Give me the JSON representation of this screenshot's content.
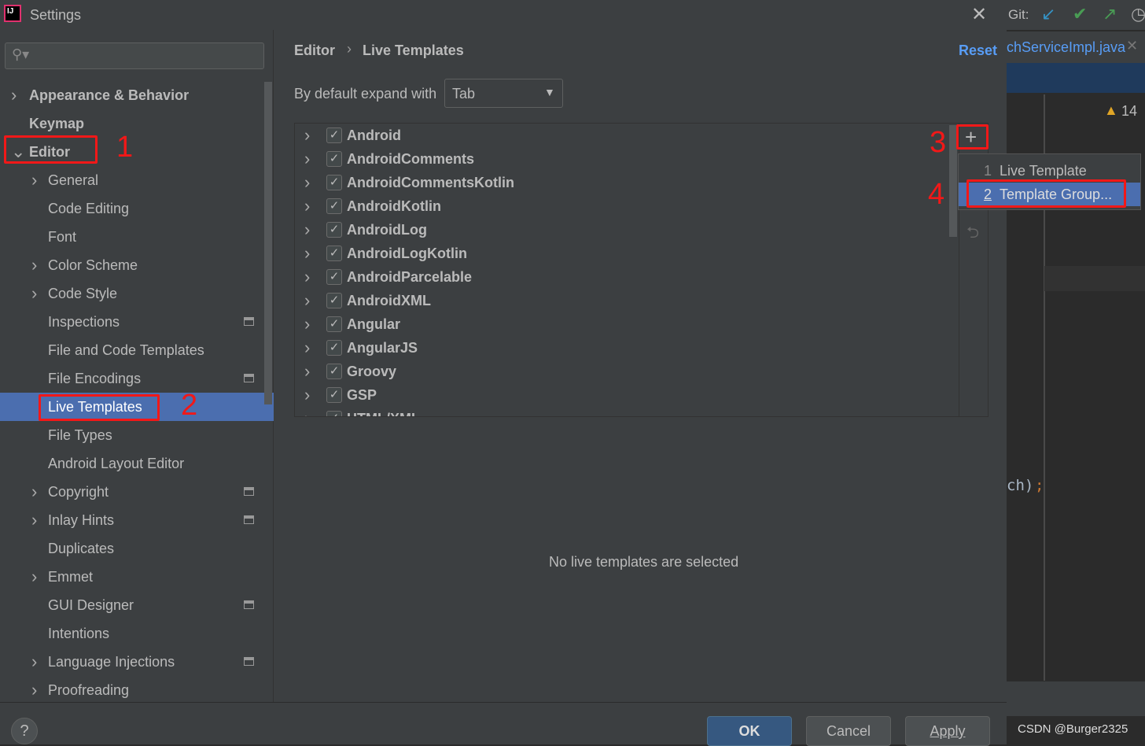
{
  "window": {
    "title": "Settings"
  },
  "search": {
    "placeholder": ""
  },
  "sidebar": {
    "items": [
      {
        "label": "Appearance & Behavior",
        "level": 0,
        "chevron": ">",
        "bold": true
      },
      {
        "label": "Keymap",
        "level": 0,
        "chevron": "",
        "bold": true
      },
      {
        "label": "Editor",
        "level": 0,
        "chevron": "v",
        "bold": true
      },
      {
        "label": "General",
        "level": 1,
        "chevron": ">"
      },
      {
        "label": "Code Editing",
        "level": 1,
        "chevron": ""
      },
      {
        "label": "Font",
        "level": 1,
        "chevron": ""
      },
      {
        "label": "Color Scheme",
        "level": 1,
        "chevron": ">"
      },
      {
        "label": "Code Style",
        "level": 1,
        "chevron": ">"
      },
      {
        "label": "Inspections",
        "level": 1,
        "chevron": "",
        "project": true
      },
      {
        "label": "File and Code Templates",
        "level": 1,
        "chevron": ""
      },
      {
        "label": "File Encodings",
        "level": 1,
        "chevron": "",
        "project": true
      },
      {
        "label": "Live Templates",
        "level": 1,
        "chevron": "",
        "selected": true
      },
      {
        "label": "File Types",
        "level": 1,
        "chevron": ""
      },
      {
        "label": "Android Layout Editor",
        "level": 1,
        "chevron": ""
      },
      {
        "label": "Copyright",
        "level": 1,
        "chevron": ">",
        "project": true
      },
      {
        "label": "Inlay Hints",
        "level": 1,
        "chevron": ">",
        "project": true
      },
      {
        "label": "Duplicates",
        "level": 1,
        "chevron": ""
      },
      {
        "label": "Emmet",
        "level": 1,
        "chevron": ">"
      },
      {
        "label": "GUI Designer",
        "level": 1,
        "chevron": "",
        "project": true
      },
      {
        "label": "Intentions",
        "level": 1,
        "chevron": ""
      },
      {
        "label": "Language Injections",
        "level": 1,
        "chevron": ">",
        "project": true
      },
      {
        "label": "Proofreading",
        "level": 1,
        "chevron": ">"
      }
    ]
  },
  "annotations": [
    "1",
    "2",
    "3",
    "4"
  ],
  "breadcrumb": {
    "parent": "Editor",
    "separator": "›",
    "current": "Live Templates"
  },
  "reset_label": "Reset",
  "expand": {
    "label": "By default expand with",
    "value": "Tab"
  },
  "template_groups": [
    "Android",
    "AndroidComments",
    "AndroidCommentsKotlin",
    "AndroidKotlin",
    "AndroidLog",
    "AndroidLogKotlin",
    "AndroidParcelable",
    "AndroidXML",
    "Angular",
    "AngularJS",
    "Groovy",
    "GSP",
    "HTML/XML"
  ],
  "add_menu": [
    {
      "mnemonic": "1",
      "label": "Live Template"
    },
    {
      "mnemonic": "2",
      "label": "Template Group...",
      "selected": true
    }
  ],
  "empty_message": "No live templates are selected",
  "buttons": {
    "ok": "OK",
    "cancel": "Cancel",
    "apply": "Apply",
    "help": "?"
  },
  "ide": {
    "git_label": "Git:",
    "tab": "chServiceImpl.java",
    "warnings": "14",
    "code": "ch)",
    "semicolon": ";",
    "watermark": "CSDN @Burger2325"
  },
  "colors": {
    "selection": "#4b6eaf",
    "link": "#589df6",
    "annotation": "#f21818"
  }
}
